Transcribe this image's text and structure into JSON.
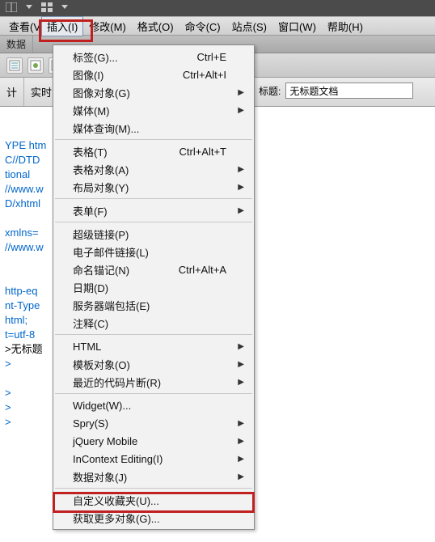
{
  "menubar": {
    "view_partial": "查看(V",
    "insert": "插入(I)",
    "modify": "修改(M)",
    "format": "格式(O)",
    "commands": "命令(C)",
    "site": "站点(S)",
    "window": "窗口(W)",
    "help": "帮助(H)"
  },
  "secondrow": {
    "data": "数据"
  },
  "midbar": {
    "tab1": "计",
    "tab2": "实时",
    "title_label": "标题:",
    "title_value": "无标题文档"
  },
  "code": {
    "l1": "YPE htm",
    "l2": "C//DTD",
    "l3": "tional",
    "l4": "//www.w",
    "l5": "D/xhtml",
    "l6": "",
    "l7": "xmlns=",
    "l8": "//www.w",
    "l9": "",
    "l10": "",
    "l11": "http-eq",
    "l12": "nt-Type",
    "l13": "html;",
    "l14": "t=utf-8",
    "l15": ">无标题",
    "l16": ">",
    "l17": "",
    "l18": ">",
    "l19": ">",
    "l20": ">"
  },
  "menu": {
    "g1": {
      "tag": {
        "l": "标签(G)...",
        "s": "Ctrl+E"
      },
      "image": {
        "l": "图像(I)",
        "s": "Ctrl+Alt+I"
      },
      "imgobj": {
        "l": "图像对象(G)",
        "arrow": true
      },
      "media": {
        "l": "媒体(M)",
        "arrow": true
      },
      "mediaquery": {
        "l": "媒体查询(M)..."
      }
    },
    "g2": {
      "table": {
        "l": "表格(T)",
        "s": "Ctrl+Alt+T"
      },
      "tableobj": {
        "l": "表格对象(A)",
        "arrow": true
      },
      "layoutobj": {
        "l": "布局对象(Y)",
        "arrow": true
      }
    },
    "g3": {
      "form": {
        "l": "表单(F)",
        "arrow": true
      }
    },
    "g4": {
      "hyperlink": {
        "l": "超级链接(P)"
      },
      "emaillink": {
        "l": "电子邮件链接(L)"
      },
      "anchor": {
        "l": "命名锚记(N)",
        "s": "Ctrl+Alt+A"
      },
      "date": {
        "l": "日期(D)"
      },
      "ssi": {
        "l": "服务器端包括(E)"
      },
      "comment": {
        "l": "注释(C)"
      }
    },
    "g5": {
      "html": {
        "l": "HTML",
        "arrow": true
      },
      "templateobj": {
        "l": "模板对象(O)",
        "arrow": true
      },
      "snippets": {
        "l": "最近的代码片断(R)",
        "arrow": true
      }
    },
    "g6": {
      "widget": {
        "l": "Widget(W)..."
      },
      "spry": {
        "l": "Spry(S)",
        "arrow": true
      },
      "jquery": {
        "l": "jQuery Mobile",
        "arrow": true
      },
      "incontext": {
        "l": "InContext Editing(I)",
        "arrow": true
      },
      "dataobj": {
        "l": "数据对象(J)",
        "arrow": true
      }
    },
    "g7": {
      "customfav": {
        "l": "自定义收藏夹(U)..."
      },
      "getmore": {
        "l": "获取更多对象(G)..."
      }
    }
  }
}
